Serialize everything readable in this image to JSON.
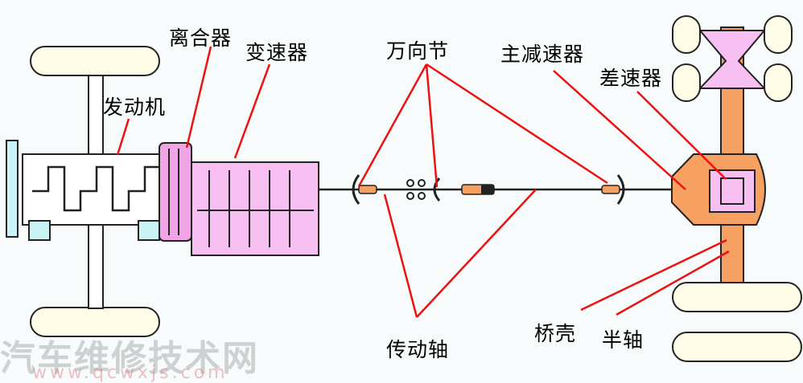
{
  "labels": {
    "clutch": "离合器",
    "gearbox": "变速器",
    "engine": "发动机",
    "ujoint": "万向节",
    "final_drive": "主减速器",
    "differential": "差速器",
    "axle_housing": "桥壳",
    "half_shaft": "半轴",
    "drive_shaft": "传动轴"
  },
  "watermark": {
    "text": "汽车维修技术网",
    "url": "www.qcwxjs.com"
  },
  "colors": {
    "wheel": "#fffde8",
    "frame": "#ffffff",
    "engine": "#ffffff",
    "gearbox": "#f8bff2",
    "clutch": "#f0a4e6",
    "axle": "#f6a062",
    "diff_box": "#f8bff2",
    "engine_block": "#c9f3f5",
    "leader": "#ee1111",
    "outline": "#222222"
  }
}
